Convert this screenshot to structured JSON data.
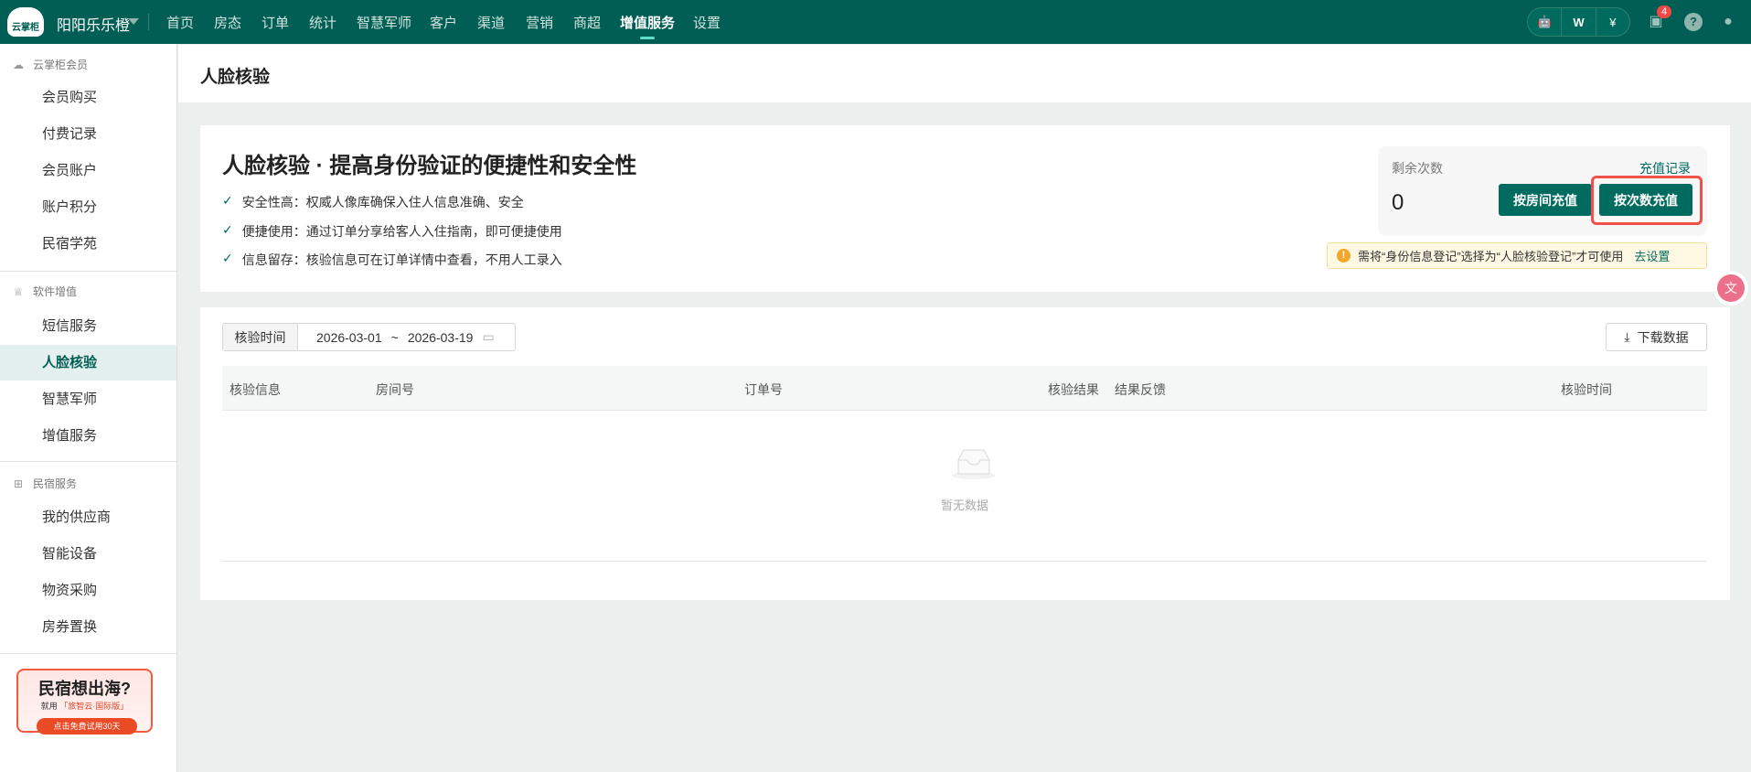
{
  "topbar": {
    "logo_text": "云掌柜",
    "store": "阳阳乐乐橙",
    "nav": [
      "首页",
      "房态",
      "订单",
      "统计",
      "智慧军师",
      "客户",
      "渠道",
      "营销",
      "商超",
      "增值服务",
      "设置"
    ],
    "active_nav": "增值服务",
    "message_count": "4"
  },
  "sidebar": {
    "groups": [
      {
        "title": "云掌柜会员",
        "items": [
          "会员购买",
          "付费记录",
          "会员账户",
          "账户积分",
          "民宿学苑"
        ]
      },
      {
        "title": "软件增值",
        "items": [
          "短信服务",
          "人脸核验",
          "智慧军师",
          "增值服务"
        ]
      },
      {
        "title": "民宿服务",
        "items": [
          "我的供应商",
          "智能设备",
          "物资采购",
          "房券置换"
        ]
      }
    ],
    "active_item": "人脸核验",
    "banner": {
      "title": "民宿想出海?",
      "sub_prefix": "就用",
      "sub_brand": "「旅智云·国际版」",
      "cta": "点击免费试用30天"
    }
  },
  "page": {
    "title": "人脸核验"
  },
  "intro": {
    "headline": "人脸核验 · 提高身份验证的便捷性和安全性",
    "features": [
      "安全性高：权威人像库确保入住人信息准确、安全",
      "便捷使用：通过订单分享给客人入住指南，即可便捷使用",
      "信息留存：核验信息可在订单详情中查看，不用人工录入"
    ]
  },
  "balance": {
    "label": "剩余次数",
    "value": "0",
    "history_link": "充值记录",
    "recharge_by_room": "按房间充值",
    "recharge_by_count": "按次数充值"
  },
  "notice": {
    "text": "需将“身份信息登记”选择为“人脸核验登记”才可使用",
    "link": "去设置"
  },
  "filter": {
    "label": "核验时间",
    "start": "2026-03-01",
    "sep": "~",
    "end": "2026-03-19"
  },
  "download": "下载数据",
  "table": {
    "columns": [
      "核验信息",
      "房间号",
      "订单号",
      "核验结果",
      "结果反馈",
      "核验时间"
    ],
    "empty": "暂无数据"
  },
  "colors": {
    "brand": "#005e54",
    "button": "#006b5e",
    "highlight": "#f2504a"
  }
}
